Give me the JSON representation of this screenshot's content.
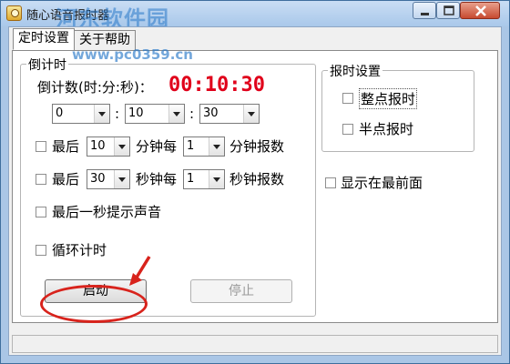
{
  "window": {
    "title": "随心语音报时器",
    "watermark": "河东软件园",
    "watermark_url": "www.pc0359.cn"
  },
  "tabs": [
    {
      "label": "定时设置",
      "active": true
    },
    {
      "label": "关于帮助",
      "active": false
    }
  ],
  "countdown": {
    "group_label": "倒计时",
    "prompt_label": "倒计数(时:分:秒)：",
    "display": "00:10:30",
    "hours": "0",
    "minutes": "10",
    "seconds": "30",
    "sep1": ":",
    "sep2": ":",
    "last_minutes": {
      "prefix": "最后",
      "value": "10",
      "middle": "分钟每",
      "interval": "1",
      "suffix": "分钟报数"
    },
    "last_seconds": {
      "prefix": "最后",
      "value": "30",
      "middle": "秒钟每",
      "interval": "1",
      "suffix": "秒钟报数"
    },
    "last_second_sound": "最后一秒提示声音",
    "loop": "循环计时",
    "start_button": "启动",
    "stop_button": "停止"
  },
  "announce": {
    "group_label": "报时设置",
    "hourly": "整点报时",
    "half_hour": "半点报时"
  },
  "always_on_top": "显示在最前面",
  "colors": {
    "timer": "#e0001a",
    "annotation": "#d8231c"
  }
}
